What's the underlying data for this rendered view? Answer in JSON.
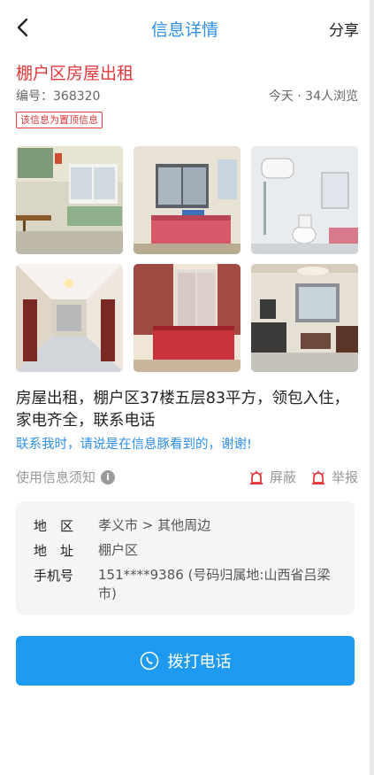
{
  "header": {
    "title": "信息详情",
    "share_label": "分享",
    "back_icon": "chevron-left-icon"
  },
  "post": {
    "title": "棚户区房屋出租",
    "id_text": "编号：368320",
    "views_text": "今天 · 34人浏览",
    "badge": "该信息为置顶信息",
    "description": "房屋出租，棚户区37楼五层83平方，领包入住，家电齐全，联系电话",
    "contact_note": "联系我时，请说是在信息豚看到的，谢谢!"
  },
  "notice": {
    "label": "使用信息须知",
    "info_icon": "info-icon",
    "block_label": "屏蔽",
    "report_label": "举报",
    "alarm_icon": "alarm-icon"
  },
  "details": {
    "region_key": "地　区",
    "region_value": "孝义市 > 其他周边",
    "address_key": "地　址",
    "address_value": "棚户区",
    "phone_key": "手机号",
    "phone_value": "151****9386 (号码归属地:山西省吕梁市)"
  },
  "call_button": {
    "label": "拨打电话",
    "icon": "phone-icon"
  },
  "colors": {
    "accent_blue": "#2f8fe6",
    "alert_red": "#e4393c",
    "button_blue": "#1e9bf0"
  }
}
